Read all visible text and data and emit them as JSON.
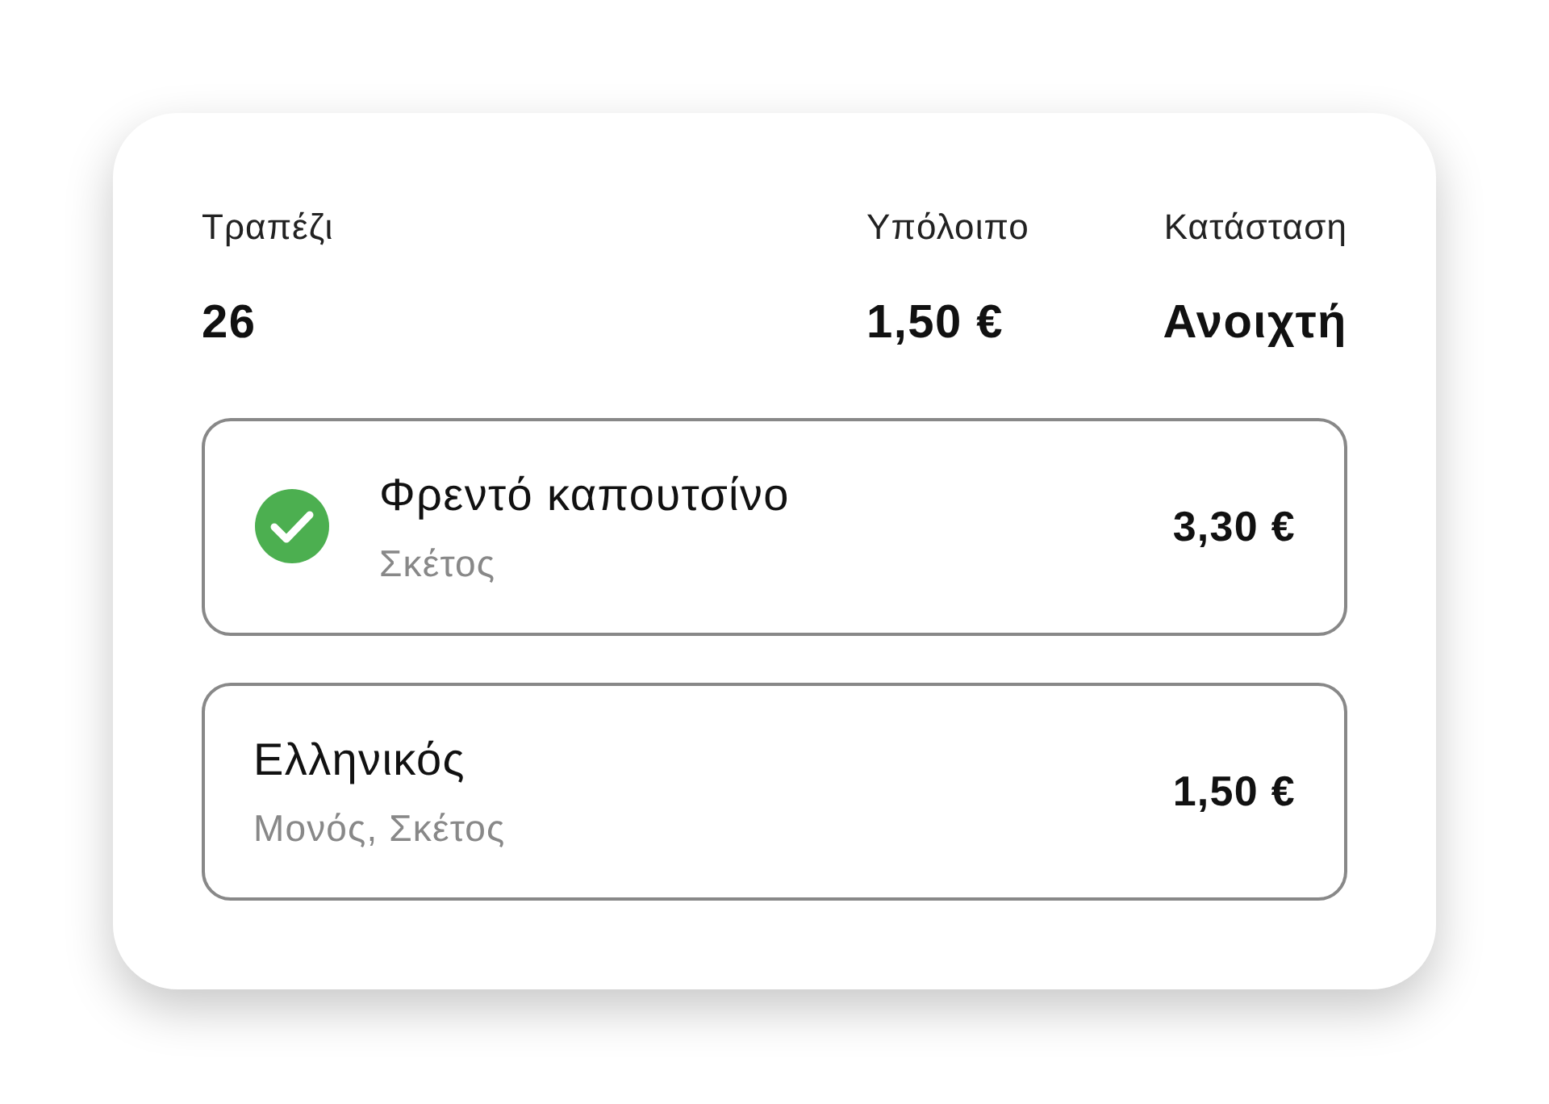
{
  "summary": [
    {
      "label": "Τραπέζι",
      "value": "26"
    },
    {
      "label": "Υπόλοιπο",
      "value": "1,50 €"
    },
    {
      "label": "Κατάσταση",
      "value": "Ανοιχτή"
    }
  ],
  "items": [
    {
      "name": "Φρεντό καπουτσίνο",
      "details": "Σκέτος",
      "price": "3,30 €",
      "checked": true
    },
    {
      "name": "Ελληνικός",
      "details": "Μονός, Σκέτος",
      "price": "1,50 €",
      "checked": false
    }
  ]
}
